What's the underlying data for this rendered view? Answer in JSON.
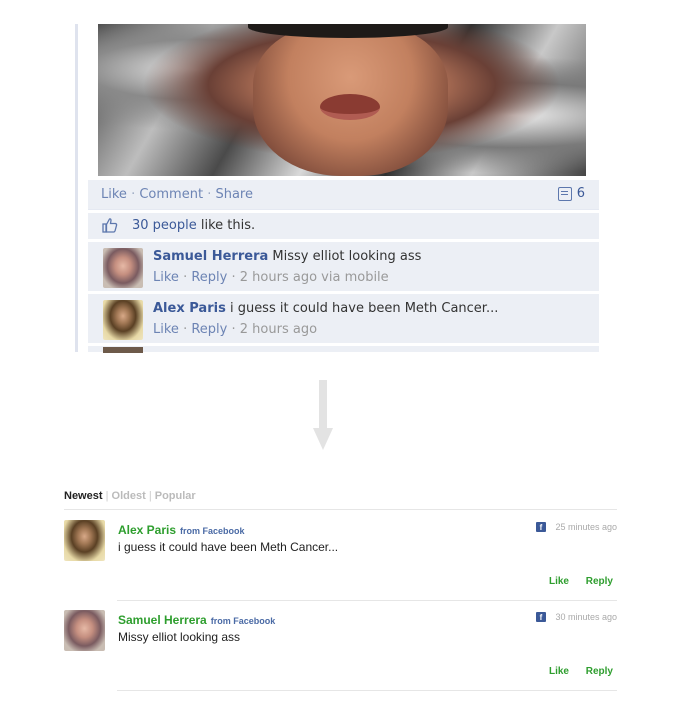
{
  "facebook_post": {
    "actions": {
      "like": "Like",
      "comment": "Comment",
      "share": "Share",
      "comment_count": "6"
    },
    "likes": {
      "count_text": "30 people",
      "suffix": " like this."
    },
    "comments": [
      {
        "name": "Samuel Herrera",
        "text": "Missy elliot looking ass",
        "like": "Like",
        "reply": "Reply",
        "meta": "2 hours ago via mobile"
      },
      {
        "name": "Alex Paris",
        "text": "i guess it could have been Meth Cancer...",
        "like": "Like",
        "reply": "Reply",
        "meta": "2 hours ago"
      }
    ]
  },
  "widget": {
    "sort": {
      "newest": "Newest",
      "oldest": "Oldest",
      "popular": "Popular"
    },
    "comments": [
      {
        "name": "Alex Paris",
        "source": "from Facebook",
        "text": "i guess it could have been Meth Cancer...",
        "time": "25 minutes ago",
        "like": "Like",
        "reply": "Reply"
      },
      {
        "name": "Samuel Herrera",
        "source": "from Facebook",
        "text": "Missy elliot looking ass",
        "time": "30 minutes ago",
        "like": "Like",
        "reply": "Reply"
      }
    ]
  },
  "colors": {
    "fb_blue": "#3b5998",
    "fb_bg": "#eceff5",
    "widget_green": "#2e9e2e"
  },
  "icons": [
    "comment-icon",
    "thumbs-up-icon",
    "down-arrow-icon",
    "facebook-icon"
  ]
}
